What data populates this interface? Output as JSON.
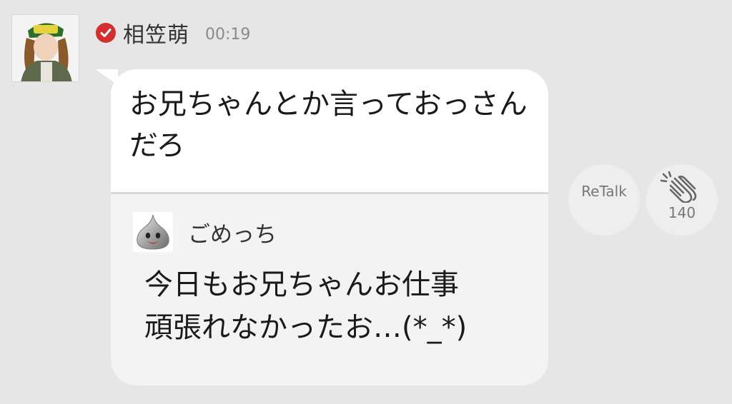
{
  "post": {
    "author": "相笠萌",
    "time": "00:19",
    "message": "お兄ちゃんとか言っておっさんだろ"
  },
  "quote": {
    "author": "ごめっち",
    "text_line1": "今日もお兄ちゃんお仕事",
    "text_line2": "頑張れなかったお…(*_*)"
  },
  "actions": {
    "retalk_label": "ReTalk",
    "clap_count": "140"
  },
  "colors": {
    "background": "#e6e6e6",
    "bubble": "#f3f3f3",
    "verified_badge": "#d32f2f"
  }
}
